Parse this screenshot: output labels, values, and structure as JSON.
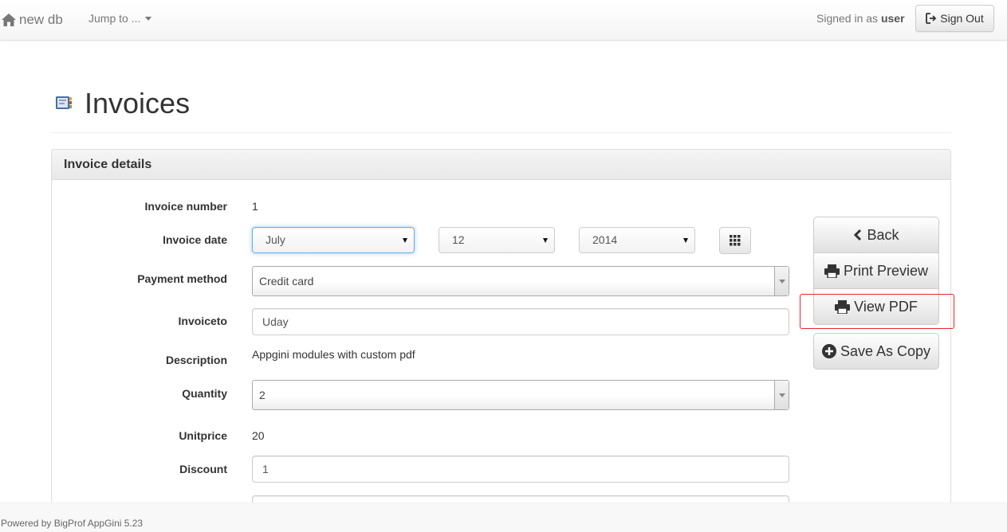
{
  "navbar": {
    "brand": "new db",
    "jump_label": "Jump to ...",
    "signed_prefix": "Signed in as",
    "user": "user",
    "signout_label": "Sign Out"
  },
  "page": {
    "title": "Invoices"
  },
  "panel": {
    "heading": "Invoice details"
  },
  "form": {
    "invoice_number": {
      "label": "Invoice number",
      "value": "1"
    },
    "invoice_date": {
      "label": "Invoice date",
      "month": "July",
      "day": "12",
      "year": "2014"
    },
    "payment_method": {
      "label": "Payment method",
      "value": "Credit card"
    },
    "invoiceto": {
      "label": "Invoiceto",
      "value": "Uday"
    },
    "description": {
      "label": "Description",
      "value": "Appgini modules with custom pdf"
    },
    "quantity": {
      "label": "Quantity",
      "value": "2"
    },
    "unitprice": {
      "label": "Unitprice",
      "value": "20"
    },
    "discount": {
      "label": "Discount",
      "value": "1"
    }
  },
  "actions": {
    "back": "Back",
    "print_preview": "Print Preview",
    "view_pdf": "View PDF",
    "save_as_copy": "Save As Copy"
  },
  "footer": {
    "text": "Powered by BigProf AppGini 5.23"
  },
  "colors": {
    "annotation": "#e8262a",
    "focus": "#66afe9"
  }
}
